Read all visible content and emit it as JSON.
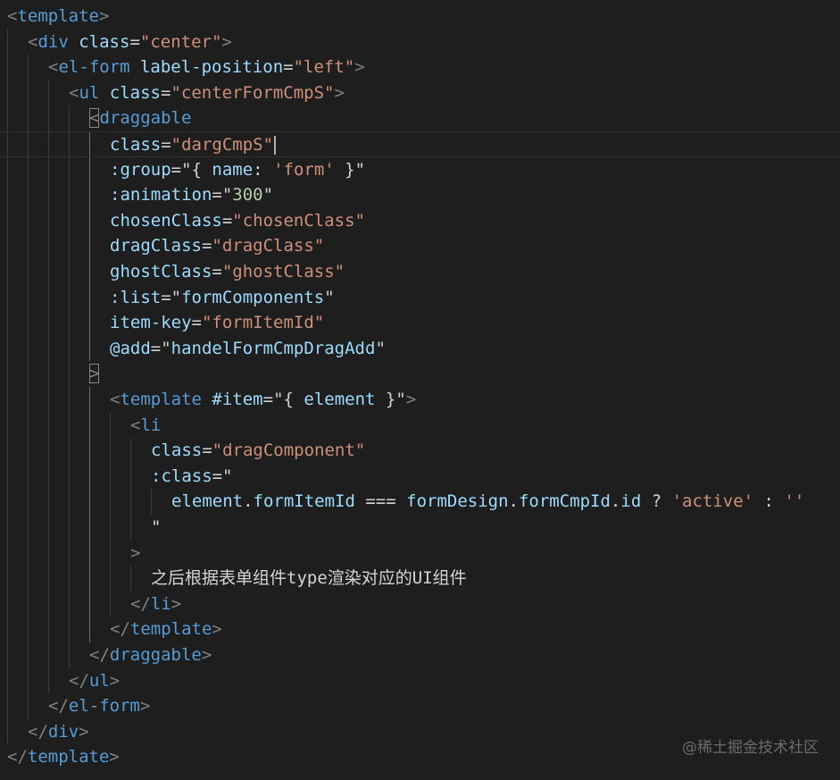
{
  "editor": {
    "current_line": 5,
    "lines": [
      {
        "indent": 0,
        "tokens": [
          [
            "punct",
            "<"
          ],
          [
            "tag",
            "template"
          ],
          [
            "punct",
            ">"
          ]
        ]
      },
      {
        "indent": 1,
        "tokens": [
          [
            "punct",
            "<"
          ],
          [
            "tag",
            "div"
          ],
          [
            "text",
            " "
          ],
          [
            "attr",
            "class"
          ],
          [
            "text",
            "="
          ],
          [
            "str",
            "\"center\""
          ],
          [
            "punct",
            ">"
          ]
        ]
      },
      {
        "indent": 2,
        "tokens": [
          [
            "punct",
            "<"
          ],
          [
            "tag",
            "el-form"
          ],
          [
            "text",
            " "
          ],
          [
            "attr",
            "label-position"
          ],
          [
            "text",
            "="
          ],
          [
            "str",
            "\"left\""
          ],
          [
            "punct",
            ">"
          ]
        ]
      },
      {
        "indent": 3,
        "tokens": [
          [
            "punct",
            "<"
          ],
          [
            "tag",
            "ul"
          ],
          [
            "text",
            " "
          ],
          [
            "attr",
            "class"
          ],
          [
            "text",
            "="
          ],
          [
            "str",
            "\"centerFormCmpS\""
          ],
          [
            "punct",
            ">"
          ]
        ]
      },
      {
        "indent": 4,
        "tokens": [
          [
            "punct",
            "<",
            "match"
          ],
          [
            "tag",
            "draggable"
          ]
        ]
      },
      {
        "indent": 5,
        "tokens": [
          [
            "attr",
            "class"
          ],
          [
            "text",
            "="
          ],
          [
            "str",
            "\"dargCmpS\""
          ],
          [
            "cursor",
            ""
          ]
        ]
      },
      {
        "indent": 5,
        "tokens": [
          [
            "attr",
            ":group"
          ],
          [
            "text",
            "=\"{ "
          ],
          [
            "attr",
            "name"
          ],
          [
            "text",
            ": "
          ],
          [
            "str",
            "'form'"
          ],
          [
            "text",
            " }\""
          ]
        ]
      },
      {
        "indent": 5,
        "tokens": [
          [
            "attr",
            ":animation"
          ],
          [
            "text",
            "=\""
          ],
          [
            "num",
            "300"
          ],
          [
            "text",
            "\""
          ]
        ]
      },
      {
        "indent": 5,
        "tokens": [
          [
            "attr",
            "chosenClass"
          ],
          [
            "text",
            "="
          ],
          [
            "str",
            "\"chosenClass\""
          ]
        ]
      },
      {
        "indent": 5,
        "tokens": [
          [
            "attr",
            "dragClass"
          ],
          [
            "text",
            "="
          ],
          [
            "str",
            "\"dragClass\""
          ]
        ]
      },
      {
        "indent": 5,
        "tokens": [
          [
            "attr",
            "ghostClass"
          ],
          [
            "text",
            "="
          ],
          [
            "str",
            "\"ghostClass\""
          ]
        ]
      },
      {
        "indent": 5,
        "tokens": [
          [
            "attr",
            ":list"
          ],
          [
            "text",
            "=\""
          ],
          [
            "attr",
            "formComponents"
          ],
          [
            "text",
            "\""
          ]
        ]
      },
      {
        "indent": 5,
        "tokens": [
          [
            "attr",
            "item-key"
          ],
          [
            "text",
            "="
          ],
          [
            "str",
            "\"formItemId\""
          ]
        ]
      },
      {
        "indent": 5,
        "tokens": [
          [
            "attr",
            "@add"
          ],
          [
            "text",
            "=\""
          ],
          [
            "attr",
            "handelFormCmpDragAdd"
          ],
          [
            "text",
            "\""
          ]
        ]
      },
      {
        "indent": 4,
        "tokens": [
          [
            "punct",
            ">",
            "match"
          ]
        ]
      },
      {
        "indent": 5,
        "tokens": [
          [
            "punct",
            "<"
          ],
          [
            "tag",
            "template"
          ],
          [
            "text",
            " "
          ],
          [
            "attr",
            "#item"
          ],
          [
            "text",
            "=\"{ "
          ],
          [
            "attr",
            "element"
          ],
          [
            "text",
            " }\""
          ],
          [
            "punct",
            ">"
          ]
        ]
      },
      {
        "indent": 6,
        "tokens": [
          [
            "punct",
            "<"
          ],
          [
            "tag",
            "li"
          ]
        ]
      },
      {
        "indent": 7,
        "tokens": [
          [
            "attr",
            "class"
          ],
          [
            "text",
            "="
          ],
          [
            "str",
            "\"dragComponent\""
          ]
        ]
      },
      {
        "indent": 7,
        "tokens": [
          [
            "attr",
            ":class"
          ],
          [
            "text",
            "=\""
          ]
        ]
      },
      {
        "indent": 8,
        "tokens": [
          [
            "attr",
            "element"
          ],
          [
            "text",
            "."
          ],
          [
            "attr",
            "formItemId"
          ],
          [
            "text",
            " === "
          ],
          [
            "attr",
            "formDesign"
          ],
          [
            "text",
            "."
          ],
          [
            "attr",
            "formCmpId"
          ],
          [
            "text",
            "."
          ],
          [
            "attr",
            "id"
          ],
          [
            "text",
            " ? "
          ],
          [
            "str",
            "'active'"
          ],
          [
            "text",
            " : "
          ],
          [
            "str",
            "''"
          ]
        ]
      },
      {
        "indent": 7,
        "tokens": [
          [
            "text",
            "\""
          ]
        ]
      },
      {
        "indent": 6,
        "tokens": [
          [
            "punct",
            ">"
          ]
        ]
      },
      {
        "indent": 7,
        "tokens": [
          [
            "text",
            "之后根据表单组件type渲染对应的UI组件"
          ]
        ]
      },
      {
        "indent": 6,
        "tokens": [
          [
            "punct",
            "</"
          ],
          [
            "tag",
            "li"
          ],
          [
            "punct",
            ">"
          ]
        ]
      },
      {
        "indent": 5,
        "tokens": [
          [
            "punct",
            "</"
          ],
          [
            "tag",
            "template"
          ],
          [
            "punct",
            ">"
          ]
        ]
      },
      {
        "indent": 4,
        "tokens": [
          [
            "punct",
            "</"
          ],
          [
            "tag",
            "draggable"
          ],
          [
            "punct",
            ">"
          ]
        ]
      },
      {
        "indent": 3,
        "tokens": [
          [
            "punct",
            "</"
          ],
          [
            "tag",
            "ul"
          ],
          [
            "punct",
            ">"
          ]
        ]
      },
      {
        "indent": 2,
        "tokens": [
          [
            "punct",
            "</"
          ],
          [
            "tag",
            "el-form"
          ],
          [
            "punct",
            ">"
          ]
        ]
      },
      {
        "indent": 1,
        "tokens": [
          [
            "punct",
            "</"
          ],
          [
            "tag",
            "div"
          ],
          [
            "punct",
            ">"
          ]
        ]
      },
      {
        "indent": 0,
        "tokens": [
          [
            "punct",
            "</"
          ],
          [
            "tag",
            "template"
          ],
          [
            "punct",
            ">"
          ]
        ]
      }
    ]
  },
  "watermark": "@稀土掘金技术社区",
  "colors": {
    "background": "#1e1e1e",
    "tag": "#569cd6",
    "attribute": "#9cdcfe",
    "string": "#ce9178",
    "number": "#b5cea8",
    "punctuation": "#808080",
    "text": "#d4d4d4"
  }
}
